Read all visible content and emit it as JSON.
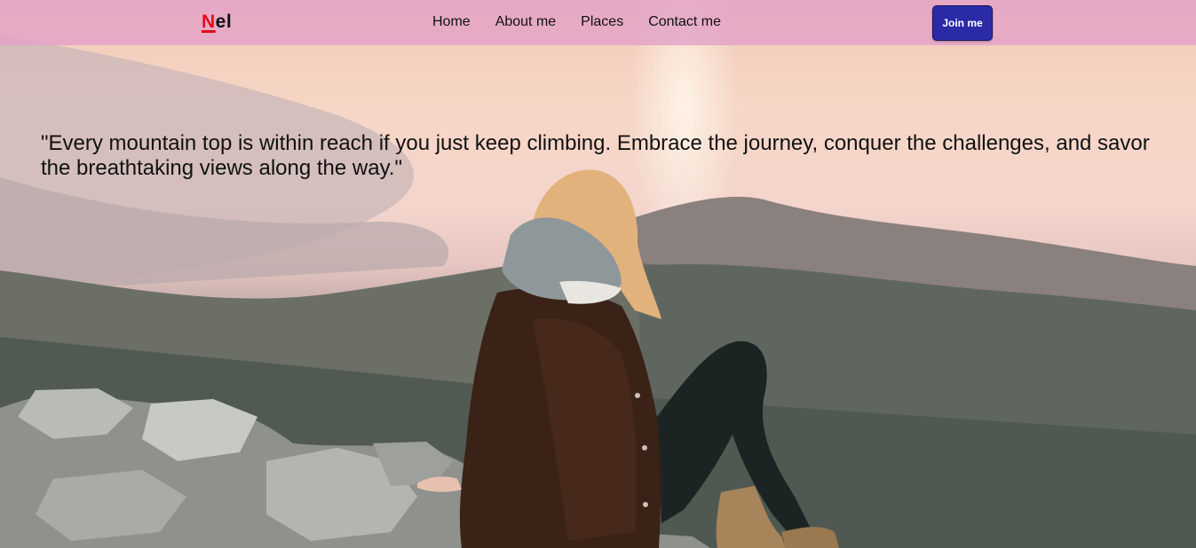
{
  "brand": {
    "first_letter": "N",
    "rest": "el"
  },
  "nav": {
    "links": [
      {
        "label": "Home"
      },
      {
        "label": "About me"
      },
      {
        "label": "Places"
      },
      {
        "label": "Contact me"
      }
    ],
    "join_label": "Join me"
  },
  "hero": {
    "quote": "\"Every mountain top is within reach if you just keep climbing. Embrace the journey, conquer the challenges, and savor the breathtaking views along the way.\""
  },
  "colors": {
    "navbar": "#e1a0c8",
    "brand_accent": "#e00b1c",
    "button": "#2b2aa6"
  }
}
